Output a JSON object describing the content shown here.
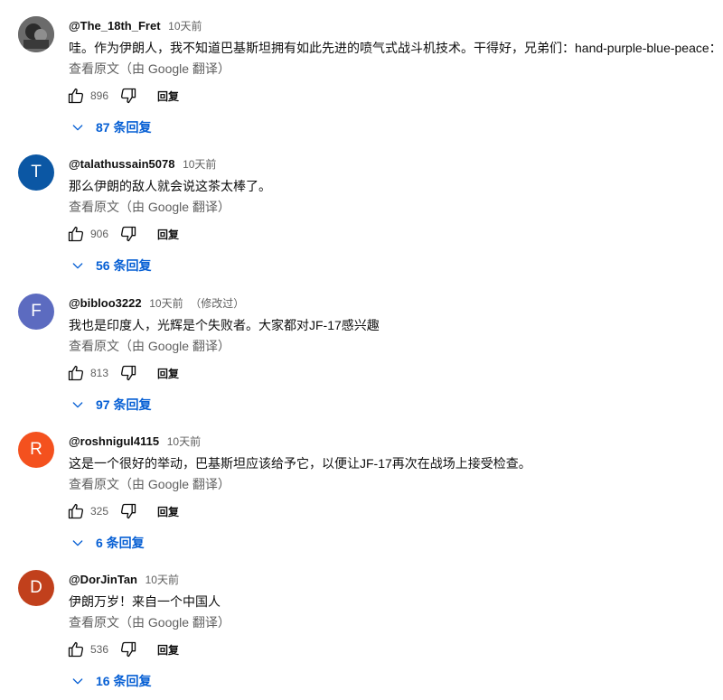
{
  "comments": [
    {
      "avatar_letter": "",
      "avatar_color": "#5a5a5a",
      "author": "@The_18th_Fret",
      "time": "10天前",
      "edited": "",
      "text": "哇。作为伊朗人，我不知道巴基斯坦拥有如此先进的喷气式战斗机技术。干得好，兄弟们：hand-purple-blue-peace：",
      "translate_label": "查看原文（由 Google 翻译）",
      "likes": "896",
      "reply_label": "回复",
      "replies_label": "87 条回复"
    },
    {
      "avatar_letter": "T",
      "avatar_color": "#0b57a4",
      "author": "@talathussain5078",
      "time": "10天前",
      "edited": "",
      "text": "那么伊朗的敌人就会说这茶太棒了。",
      "translate_label": "查看原文（由 Google 翻译）",
      "likes": "906",
      "reply_label": "回复",
      "replies_label": "56 条回复"
    },
    {
      "avatar_letter": "F",
      "avatar_color": "#5c6bc0",
      "author": "@bibloo3222",
      "time": "10天前",
      "edited": "（修改过）",
      "text": "我也是印度人，光辉是个失败者。大家都对JF-17感兴趣",
      "translate_label": "查看原文（由 Google 翻译）",
      "likes": "813",
      "reply_label": "回复",
      "replies_label": "97 条回复"
    },
    {
      "avatar_letter": "R",
      "avatar_color": "#f4511e",
      "author": "@roshnigul4115",
      "time": "10天前",
      "edited": "",
      "text": "这是一个很好的举动，巴基斯坦应该给予它，以便让JF-17再次在战场上接受检查。",
      "translate_label": "查看原文（由 Google 翻译）",
      "likes": "325",
      "reply_label": "回复",
      "replies_label": "6 条回复"
    },
    {
      "avatar_letter": "D",
      "avatar_color": "#c1401c",
      "author": "@DorJinTan",
      "time": "10天前",
      "edited": "",
      "text": "伊朗万岁！来自一个中国人",
      "translate_label": "查看原文（由 Google 翻译）",
      "likes": "536",
      "reply_label": "回复",
      "replies_label": "16 条回复"
    }
  ],
  "icons": {
    "like": "thumbs-up-icon",
    "dislike": "thumbs-down-icon",
    "expand": "chevron-down-icon"
  },
  "colors": {
    "link_blue": "#065fd4",
    "secondary_text": "#606060"
  }
}
